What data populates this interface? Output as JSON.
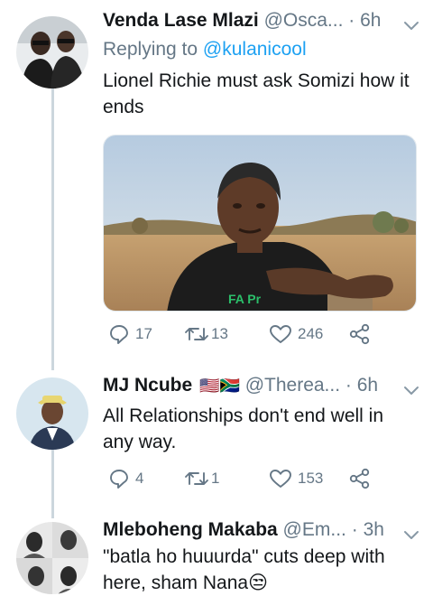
{
  "tweets": [
    {
      "name": "Venda Lase Mlazi",
      "handle": "@Osca...",
      "separator": "·",
      "time": "6h",
      "replying_prefix": "Replying to",
      "replying_to": "@kulanicool",
      "text": "Lionel Richie must ask Somizi how it ends",
      "media_text": "FA Pr",
      "replies": "17",
      "retweets": "13",
      "likes": "246"
    },
    {
      "name": "MJ Ncube",
      "flags": "🇺🇸🇿🇦",
      "handle": "@Therea...",
      "separator": "·",
      "time": "6h",
      "text": "All Relationships don't end well in any way.",
      "replies": "4",
      "retweets": "1",
      "likes": "153"
    },
    {
      "name": "Mleboheng Makaba",
      "handle": "@Em...",
      "separator": "·",
      "time": "3h",
      "text": "\"batla ho huuurda\" cuts deep with here, sham Nana😒"
    }
  ],
  "colors": {
    "link": "#1da1f2",
    "secondary_text": "#657786",
    "primary_text": "#14171a",
    "thread_line": "#ccd6dd"
  },
  "icons": [
    "reply-icon",
    "retweet-icon",
    "like-icon",
    "share-icon",
    "caret-down-icon"
  ]
}
